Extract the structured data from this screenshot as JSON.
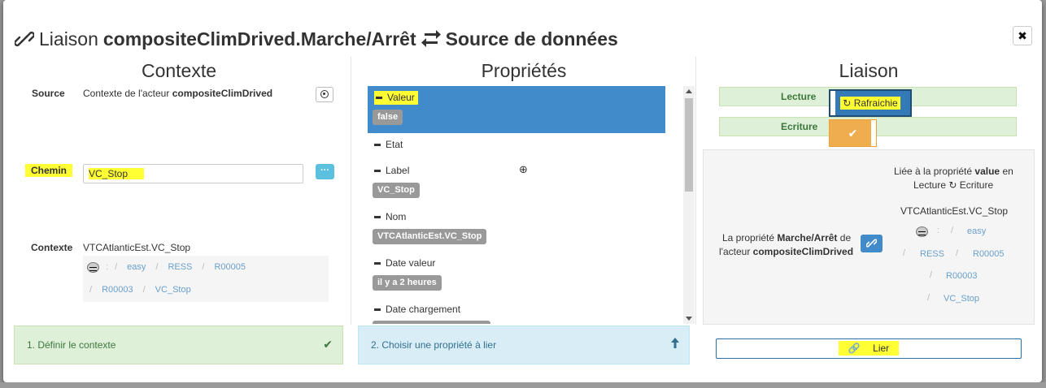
{
  "title": {
    "prefix": "Liaison",
    "bold_name": "compositeClimDrived.Marche/Arrêt",
    "suffix": "Source de données",
    "close": "✖"
  },
  "columns": {
    "contexte": "Contexte",
    "proprietes": "Propriétés",
    "liaison": "Liaison"
  },
  "contexte": {
    "source_label": "Source",
    "source_text": "Contexte de l'acteur",
    "source_actor": "compositeClimDrived",
    "chemin_label": "Chemin",
    "chemin_value": "VC_Stop",
    "menu_btn": "···",
    "contexte_label": "Contexte",
    "contexte_value": "VTCAtlanticEst.VC_Stop",
    "crumbs_row1": [
      ":",
      "easy",
      "RESS",
      "R00005"
    ],
    "crumbs_row2": [
      "R00003",
      "VC_Stop"
    ],
    "step": "1. Définir le contexte",
    "step_icon": "✔"
  },
  "proprietes": {
    "items": [
      {
        "name": "Valeur",
        "value": "false"
      },
      {
        "name": "Etat",
        "value": ""
      },
      {
        "name": "Label",
        "value": "VC_Stop"
      },
      {
        "name": "Nom",
        "value": "VTCAtlanticEst.VC_Stop"
      },
      {
        "name": "Date valeur",
        "value": "il y a 2 heures"
      },
      {
        "name": "Date chargement",
        "value": ""
      }
    ],
    "add_icon": "⊕",
    "step": "2. Choisir une propriété à lier",
    "step_icon": "🡑"
  },
  "liaison": {
    "lecture_label": "Lecture",
    "refresh_label": "Rafraichie",
    "ecriture_label": "Ecriture",
    "check": "✔",
    "desc_prefix": "La propriété",
    "desc_prop": "Marche/Arrêt",
    "desc_mid": "de",
    "desc_mid2": "l'acteur",
    "desc_actor": "compositeClimDrived",
    "linked_prefix": "Liée à la propriété",
    "linked_prop": "value",
    "linked_suffix": "en",
    "linked_line2_a": "Lecture",
    "linked_line2_b": "Ecriture",
    "linked_path": "VTCAtlanticEst.VC_Stop",
    "crumbs": [
      ":",
      "easy",
      "RESS",
      "R00005",
      "R00003",
      "VC_Stop"
    ],
    "lier": "Lier"
  }
}
